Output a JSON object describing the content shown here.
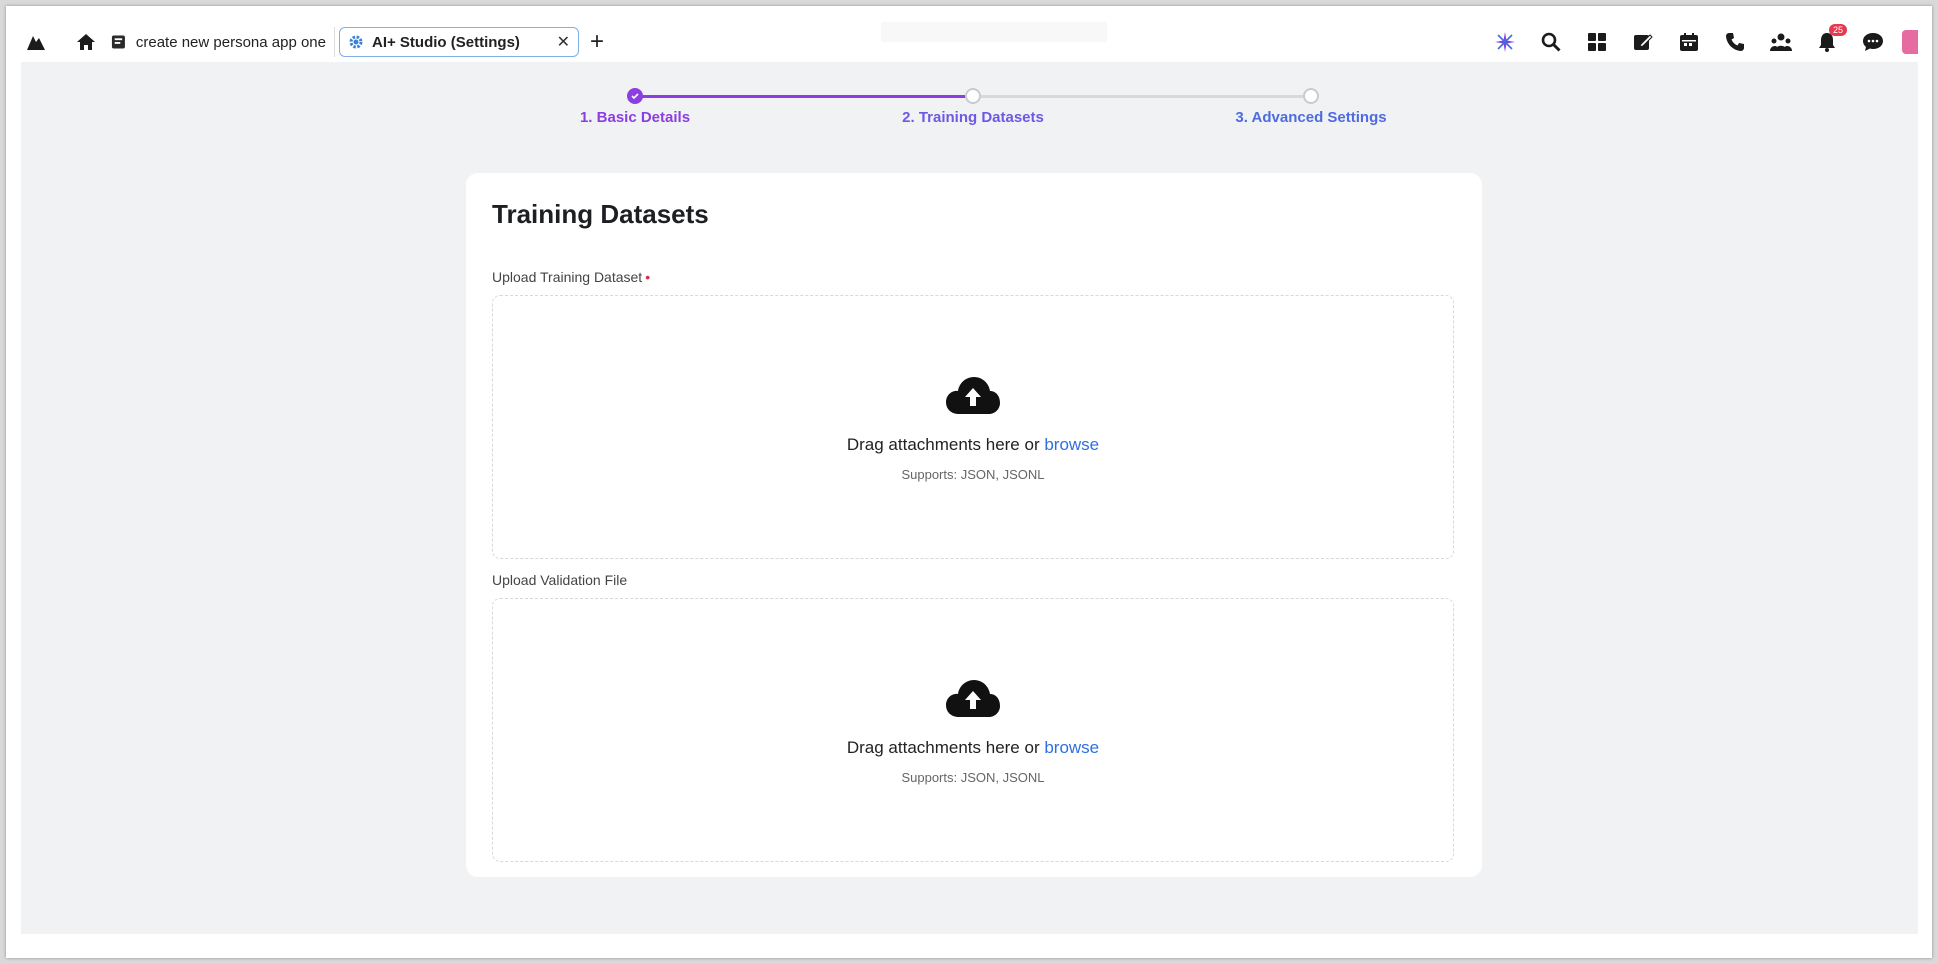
{
  "browser": {
    "tabs": [
      {
        "label": "create new persona app one"
      },
      {
        "label": "AI+ Studio (Settings)"
      }
    ],
    "notifications_badge": "25"
  },
  "stepper": {
    "steps": [
      {
        "label": "1. Basic Details",
        "status": "completed"
      },
      {
        "label": "2. Training Datasets",
        "status": "current"
      },
      {
        "label": "3. Advanced Settings",
        "status": "upcoming"
      }
    ],
    "colors": {
      "active": "#8b3fe0",
      "label_start": "#8b3fe0",
      "label_end": "#4f6be0",
      "inactive": "#d7d9de"
    }
  },
  "card": {
    "title": "Training Datasets",
    "training_upload": {
      "label": "Upload Training Dataset",
      "required_marker": "•",
      "drag_text": "Drag attachments here or ",
      "browse_text": "browse",
      "supports": "Supports: JSON, JSONL"
    },
    "validation_upload": {
      "label": "Upload Validation File",
      "drag_text": "Drag attachments here or ",
      "browse_text": "browse",
      "supports": "Supports: JSON, JSONL"
    }
  }
}
